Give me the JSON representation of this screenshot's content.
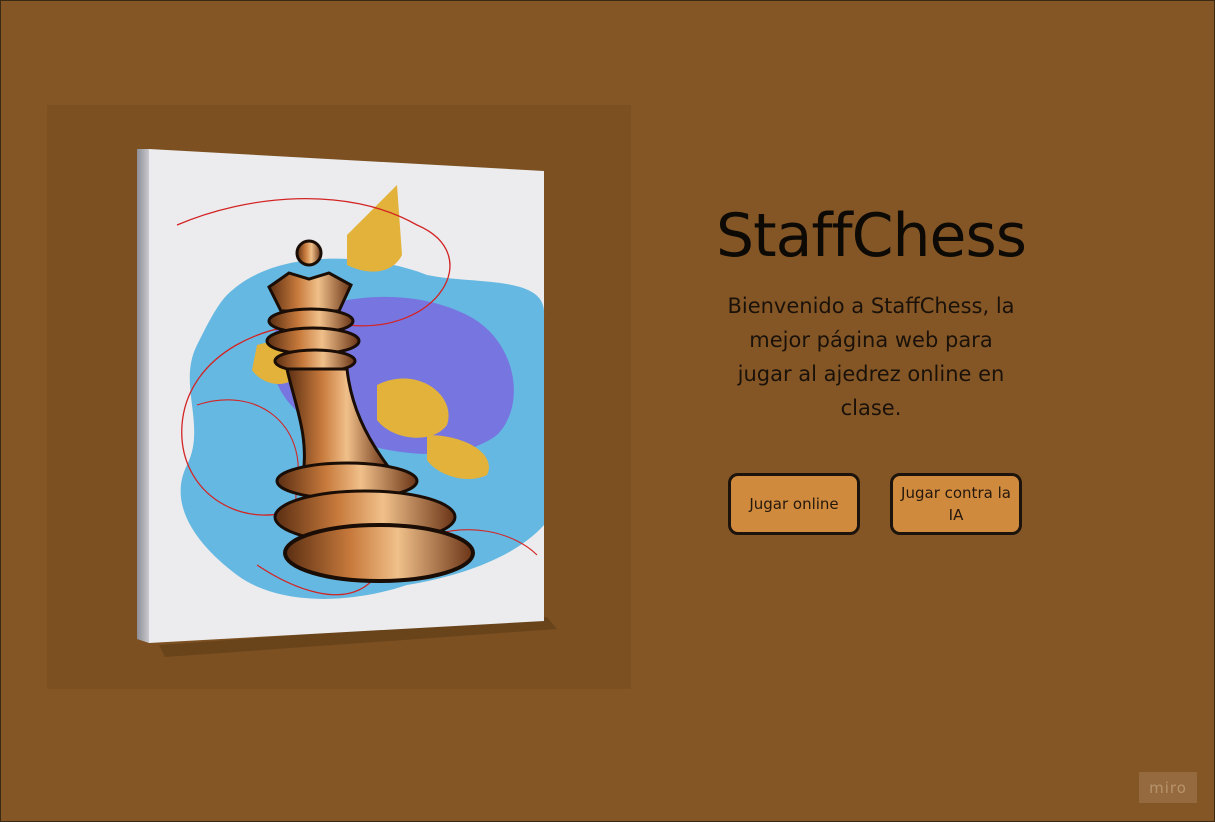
{
  "page": {
    "background": "#855625",
    "panel_background": "#7c5021"
  },
  "hero": {
    "image_icon": "chess-queen-canvas-icon"
  },
  "header": {
    "title": "StaffChess",
    "subtitle": "Bienvenido a StaffChess, la mejor página web para jugar al ajedrez online en clase."
  },
  "actions": {
    "play_online_label": "Jugar online",
    "play_ai_label": "Jugar contra la IA",
    "button_color": "#d08a3e"
  },
  "watermark": {
    "text": "miro"
  }
}
